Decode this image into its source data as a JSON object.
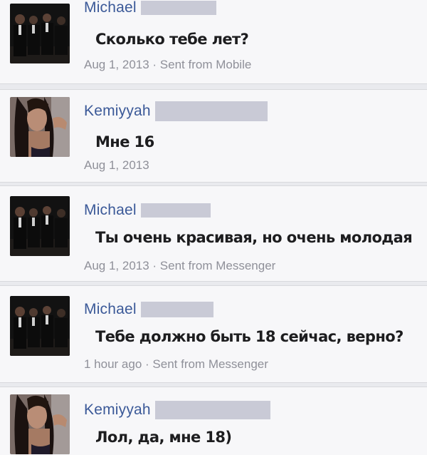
{
  "thread": {
    "messages": [
      {
        "sender": "Michael",
        "avatar": "group-photo-men-in-suits",
        "text": "Сколько тебе лет?",
        "timestamp": "Aug 1, 2013 · Sent from Mobile"
      },
      {
        "sender": "Kemiyyah",
        "avatar": "woman-selfie-photo",
        "text": "Мне 16",
        "timestamp": "Aug 1, 2013"
      },
      {
        "sender": "Michael",
        "avatar": "group-photo-men-in-suits",
        "text": "Ты очень красивая, но очень молодая",
        "timestamp": "Aug 1, 2013 · Sent from Messenger"
      },
      {
        "sender": "Michael",
        "avatar": "group-photo-men-in-suits",
        "text": "Тебе должно быть 18 сейчас, верно?",
        "timestamp": "1 hour ago · Sent from Messenger"
      },
      {
        "sender": "Kemiyyah",
        "avatar": "woman-selfie-photo",
        "text": "Лол, да, мне 18)",
        "timestamp": ""
      }
    ]
  },
  "colors": {
    "sender_link": "#3b5998",
    "message_text": "#1d1d1f",
    "meta_text": "#8f9099",
    "redaction": "#c9cad6",
    "card_bg": "#f7f7f9",
    "divider_bg": "#e9eaee"
  }
}
